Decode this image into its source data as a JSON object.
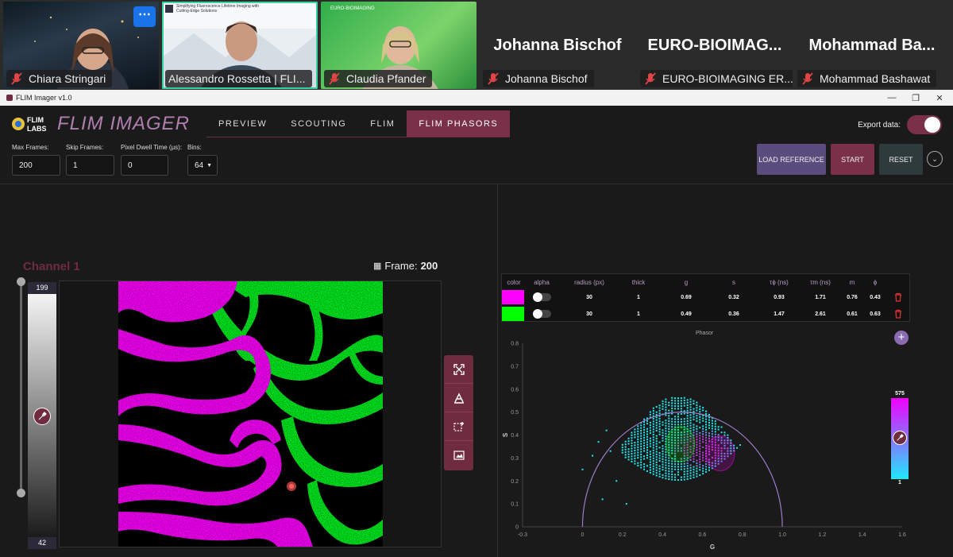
{
  "meeting": {
    "participants": [
      {
        "name": "Chiara Stringari",
        "muted": true
      },
      {
        "name": "Alessandro Rossetta | FLI...",
        "muted": false
      },
      {
        "name": "Claudia Pfander",
        "muted": true
      },
      {
        "name": "Johanna Bischof",
        "big": "Johanna Bischof",
        "muted": true
      },
      {
        "name": "EURO-BIOIMAGING ER...",
        "big": "EURO-BIOIMAG...",
        "muted": true
      },
      {
        "name": "Mohammad Bashawat",
        "big": "Mohammad  Ba...",
        "muted": true
      }
    ],
    "more_label": "⋯",
    "slide_text": "Simplifying Fluorescence Lifetime Imaging with Cutting-Edge Solutions",
    "banner_text": "EURO-BIOIMAGING"
  },
  "window": {
    "title": "FLIM Imager v1.0",
    "minimize": "—",
    "maximize": "❐",
    "close": "✕"
  },
  "app": {
    "logo_text": "FLIM IMAGER",
    "tabs": [
      {
        "label": "PREVIEW",
        "active": false
      },
      {
        "label": "SCOUTING",
        "active": false
      },
      {
        "label": "FLIM",
        "active": false
      },
      {
        "label": "FLIM PHASORS",
        "active": true
      }
    ],
    "export_label": "Export data:",
    "export_on": true,
    "fields": {
      "max_frames": {
        "label": "Max Frames:",
        "value": "200"
      },
      "skip_frames": {
        "label": "Skip Frames:",
        "value": "1"
      },
      "dwell": {
        "label": "Pixel Dwell Time (µs):",
        "value": "0"
      },
      "bins": {
        "label": "Bins:",
        "value": "64"
      }
    },
    "buttons": {
      "load": "LOAD REFERENCE",
      "start": "START",
      "reset": "RESET"
    },
    "colors": {
      "accent": "#7a3049",
      "magenta": "#ff00ff",
      "green": "#00ff00",
      "cyan": "#20e8f0"
    }
  },
  "channel": {
    "title": "Channel 1",
    "frame_label": "Frame:",
    "frame_value": "200",
    "lut_max": "199",
    "lut_min": "42"
  },
  "table": {
    "headers": [
      "color",
      "alpha",
      "radius (px)",
      "thick",
      "g",
      "s",
      "τϕ (ns)",
      "τm (ns)",
      "m",
      "ϕ"
    ],
    "rows": [
      {
        "color": "#ff00ff",
        "radius": "30",
        "thick": "1",
        "g": "0.69",
        "s": "0.32",
        "tphi": "0.93",
        "tm": "1.71",
        "m": "0.76",
        "phi": "0.43"
      },
      {
        "color": "#00ff00",
        "radius": "30",
        "thick": "1",
        "g": "0.49",
        "s": "0.36",
        "tphi": "1.47",
        "tm": "2.61",
        "m": "0.61",
        "phi": "0.63"
      }
    ]
  },
  "chart_data": {
    "type": "scatter",
    "title": "Phasor",
    "xlabel": "G",
    "ylabel": "S",
    "xlim": [
      -0.3,
      1.6
    ],
    "ylim": [
      0,
      0.8
    ],
    "x_ticks": [
      "-0.3",
      "0",
      "0.2",
      "0.4",
      "0.6",
      "0.8",
      "1.0",
      "1.2",
      "1.4",
      "1.6"
    ],
    "y_ticks": [
      "0",
      "0.1",
      "0.2",
      "0.3",
      "0.4",
      "0.5",
      "0.6",
      "0.7",
      "0.8"
    ],
    "semicircle": {
      "center_g": 0.5,
      "radius": 0.5
    },
    "cluster": {
      "g_range": [
        0.2,
        0.82
      ],
      "s_range": [
        0.1,
        0.57
      ]
    },
    "rois": [
      {
        "g": 0.69,
        "s": 0.32,
        "color": "#ff00ff"
      },
      {
        "g": 0.49,
        "s": 0.36,
        "color": "#00ff00"
      }
    ],
    "colorbar": {
      "max": "575",
      "min": "1"
    }
  }
}
